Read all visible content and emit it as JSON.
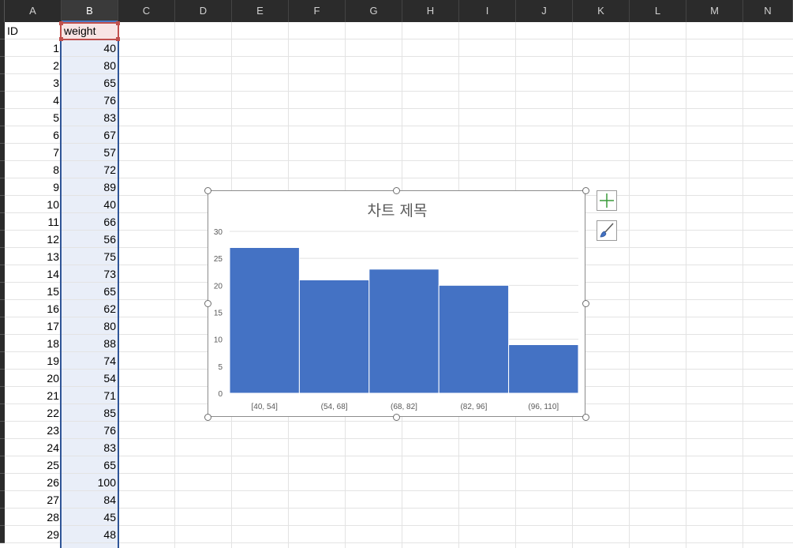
{
  "columns": [
    "A",
    "B",
    "C",
    "D",
    "E",
    "F",
    "G",
    "H",
    "I",
    "J",
    "K",
    "L",
    "M",
    "N"
  ],
  "header_row": {
    "A": "ID",
    "B": "weight"
  },
  "rows": [
    {
      "id": "1",
      "weight": "40"
    },
    {
      "id": "2",
      "weight": "80"
    },
    {
      "id": "3",
      "weight": "65"
    },
    {
      "id": "4",
      "weight": "76"
    },
    {
      "id": "5",
      "weight": "83"
    },
    {
      "id": "6",
      "weight": "67"
    },
    {
      "id": "7",
      "weight": "57"
    },
    {
      "id": "8",
      "weight": "72"
    },
    {
      "id": "9",
      "weight": "89"
    },
    {
      "id": "10",
      "weight": "40"
    },
    {
      "id": "11",
      "weight": "66"
    },
    {
      "id": "12",
      "weight": "56"
    },
    {
      "id": "13",
      "weight": "75"
    },
    {
      "id": "14",
      "weight": "73"
    },
    {
      "id": "15",
      "weight": "65"
    },
    {
      "id": "16",
      "weight": "62"
    },
    {
      "id": "17",
      "weight": "80"
    },
    {
      "id": "18",
      "weight": "88"
    },
    {
      "id": "19",
      "weight": "74"
    },
    {
      "id": "20",
      "weight": "54"
    },
    {
      "id": "21",
      "weight": "71"
    },
    {
      "id": "22",
      "weight": "85"
    },
    {
      "id": "23",
      "weight": "76"
    },
    {
      "id": "24",
      "weight": "83"
    },
    {
      "id": "25",
      "weight": "65"
    },
    {
      "id": "26",
      "weight": "100"
    },
    {
      "id": "27",
      "weight": "84"
    },
    {
      "id": "28",
      "weight": "45"
    },
    {
      "id": "29",
      "weight": "48"
    }
  ],
  "chart_buttons": {
    "add_element_icon": "plus-icon",
    "style_icon": "paintbrush-icon"
  },
  "chart_data": {
    "type": "bar",
    "title": "차트 제목",
    "categories": [
      "[40, 54]",
      "(54, 68]",
      "(68, 82]",
      "(82, 96]",
      "(96, 110]"
    ],
    "values": [
      27,
      21,
      23,
      20,
      9
    ],
    "ylim": [
      0,
      30
    ],
    "yticks": [
      "0",
      "5",
      "10",
      "15",
      "20",
      "25",
      "30"
    ],
    "xlabel": "",
    "ylabel": "",
    "grid": true,
    "bar_color": "#4472c4"
  }
}
